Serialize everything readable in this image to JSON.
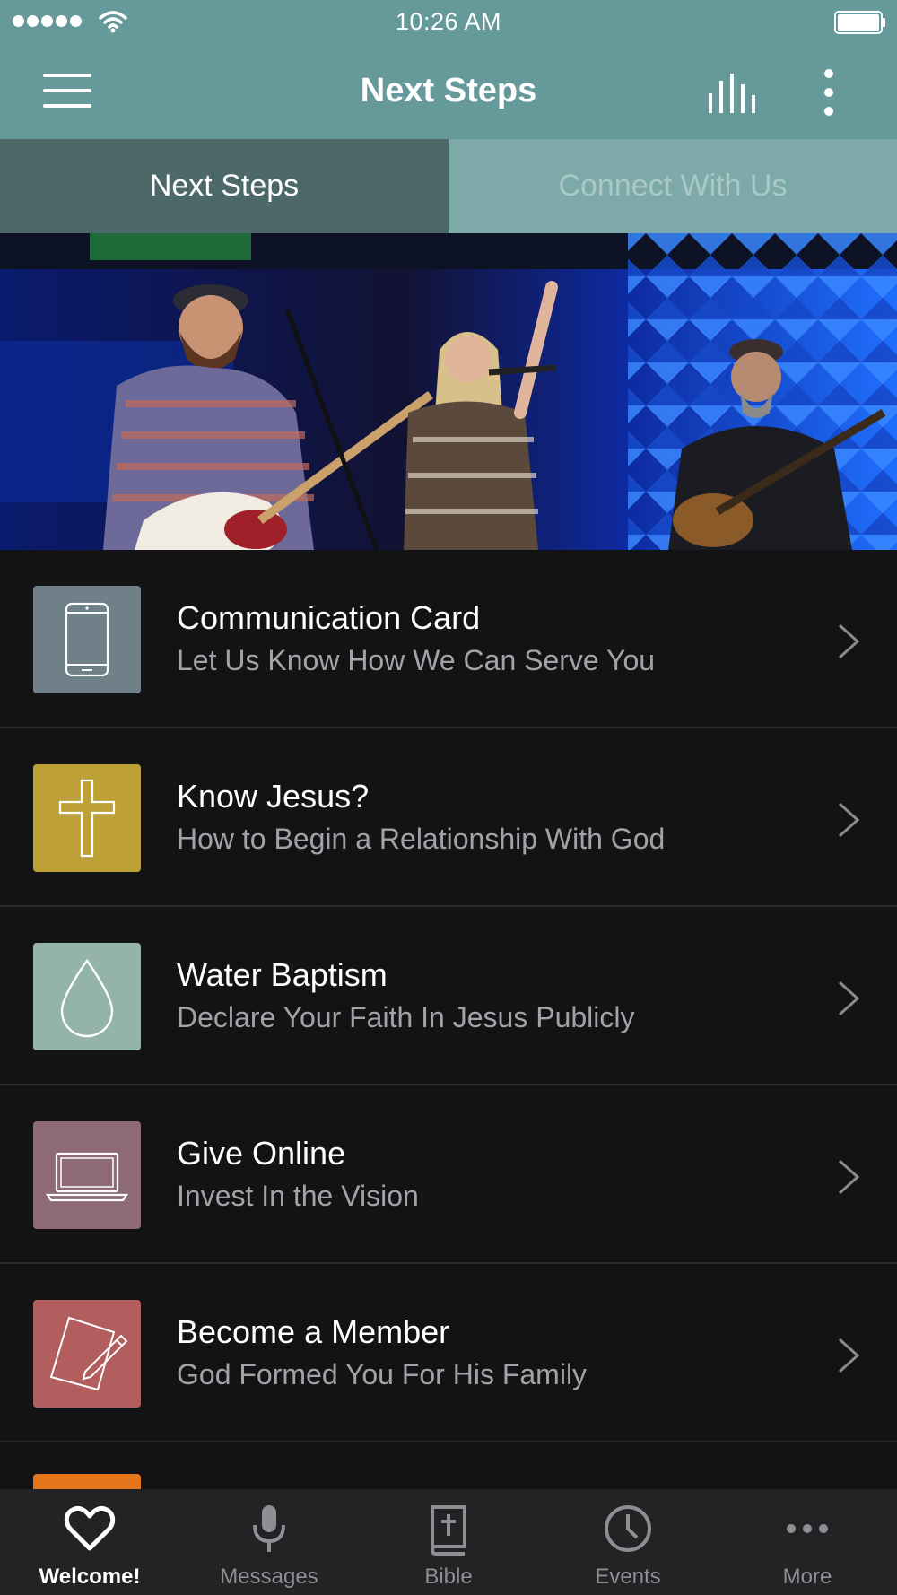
{
  "status_bar": {
    "time": "10:26 AM",
    "signal_icon": "signal-dots-icon",
    "wifi_icon": "wifi-icon",
    "battery_icon": "battery-icon"
  },
  "app_bar": {
    "title": "Next Steps",
    "menu_icon": "hamburger-menu-icon",
    "audio_icon": "audio-bars-icon",
    "more_icon": "vertical-dots-icon",
    "color": "#66999a"
  },
  "tabs": [
    {
      "label": "Next Steps",
      "active": true
    },
    {
      "label": "Connect With Us",
      "active": false
    }
  ],
  "hero": {
    "image": "worship band on stage with guitars and microphones"
  },
  "list": {
    "items": [
      {
        "title": "Communication Card",
        "subtitle": "Let Us Know How We Can Serve You",
        "icon": "smartphone-icon",
        "color": "#6f8088"
      },
      {
        "title": "Know Jesus?",
        "subtitle": "How to Begin a Relationship With God",
        "icon": "cross-icon",
        "color": "#bda036"
      },
      {
        "title": "Water Baptism",
        "subtitle": "Declare Your Faith In Jesus Publicly",
        "icon": "water-drop-icon",
        "color": "#94b3ab"
      },
      {
        "title": "Give Online",
        "subtitle": "Invest In the Vision",
        "icon": "laptop-icon",
        "color": "#8e6a78"
      },
      {
        "title": "Become a Member",
        "subtitle": "God Formed You For His Family",
        "icon": "paper-pencil-icon",
        "color": "#b25e5e"
      }
    ],
    "partial_item_color": "#e4761c"
  },
  "tab_bar": {
    "items": [
      {
        "label": "Welcome!",
        "icon": "heart-icon",
        "active": true
      },
      {
        "label": "Messages",
        "icon": "microphone-icon",
        "active": false
      },
      {
        "label": "Bible",
        "icon": "bible-icon",
        "active": false
      },
      {
        "label": "Events",
        "icon": "clock-icon",
        "active": false
      },
      {
        "label": "More",
        "icon": "more-dots-icon",
        "active": false
      }
    ]
  }
}
